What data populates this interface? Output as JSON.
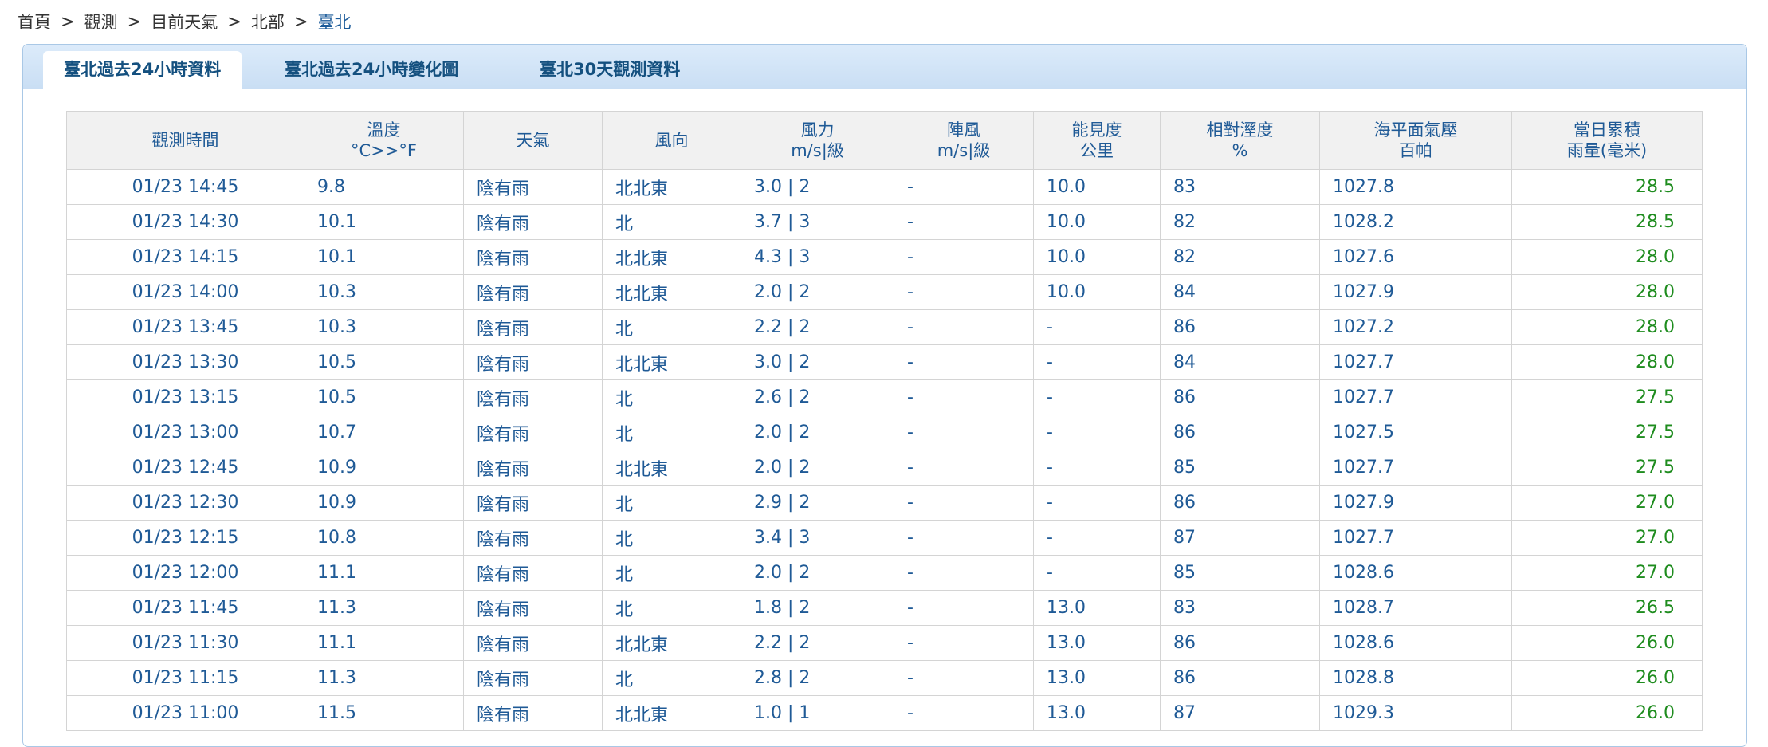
{
  "breadcrumb": {
    "home": "首頁",
    "observe": "觀測",
    "current": "目前天氣",
    "region": "北部",
    "city": "臺北",
    "separator": ">"
  },
  "tabs": [
    {
      "label_prefix": "臺北過去",
      "label_num": "24",
      "label_suffix": "小時資料",
      "active": true
    },
    {
      "label_prefix": "臺北過去",
      "label_num": "24",
      "label_suffix": "小時變化圖",
      "active": false
    },
    {
      "label_prefix": "臺北",
      "label_num": "30",
      "label_suffix": "天觀測資料",
      "active": false
    }
  ],
  "table": {
    "headers": [
      {
        "line1": "觀測時間",
        "line2": ""
      },
      {
        "line1": "溫度",
        "line2": "°C>>°F"
      },
      {
        "line1": "天氣",
        "line2": ""
      },
      {
        "line1": "風向",
        "line2": ""
      },
      {
        "line1": "風力",
        "line2": "m/s|級"
      },
      {
        "line1": "陣風",
        "line2": "m/s|級"
      },
      {
        "line1": "能見度",
        "line2": "公里"
      },
      {
        "line1": "相對溼度",
        "line2": "%"
      },
      {
        "line1": "海平面氣壓",
        "line2": "百帕"
      },
      {
        "line1": "當日累積",
        "line2": "雨量(毫米)"
      }
    ],
    "rows": [
      [
        "01/23 14:45",
        "9.8",
        "陰有雨",
        "北北東",
        "3.0 | 2",
        "-",
        "10.0",
        "83",
        "1027.8",
        "28.5"
      ],
      [
        "01/23 14:30",
        "10.1",
        "陰有雨",
        "北",
        "3.7 | 3",
        "-",
        "10.0",
        "82",
        "1028.2",
        "28.5"
      ],
      [
        "01/23 14:15",
        "10.1",
        "陰有雨",
        "北北東",
        "4.3 | 3",
        "-",
        "10.0",
        "82",
        "1027.6",
        "28.0"
      ],
      [
        "01/23 14:00",
        "10.3",
        "陰有雨",
        "北北東",
        "2.0 | 2",
        "-",
        "10.0",
        "84",
        "1027.9",
        "28.0"
      ],
      [
        "01/23 13:45",
        "10.3",
        "陰有雨",
        "北",
        "2.2 | 2",
        "-",
        "-",
        "86",
        "1027.2",
        "28.0"
      ],
      [
        "01/23 13:30",
        "10.5",
        "陰有雨",
        "北北東",
        "3.0 | 2",
        "-",
        "-",
        "84",
        "1027.7",
        "28.0"
      ],
      [
        "01/23 13:15",
        "10.5",
        "陰有雨",
        "北",
        "2.6 | 2",
        "-",
        "-",
        "86",
        "1027.7",
        "27.5"
      ],
      [
        "01/23 13:00",
        "10.7",
        "陰有雨",
        "北",
        "2.0 | 2",
        "-",
        "-",
        "86",
        "1027.5",
        "27.5"
      ],
      [
        "01/23 12:45",
        "10.9",
        "陰有雨",
        "北北東",
        "2.0 | 2",
        "-",
        "-",
        "85",
        "1027.7",
        "27.5"
      ],
      [
        "01/23 12:30",
        "10.9",
        "陰有雨",
        "北",
        "2.9 | 2",
        "-",
        "-",
        "86",
        "1027.9",
        "27.0"
      ],
      [
        "01/23 12:15",
        "10.8",
        "陰有雨",
        "北",
        "3.4 | 3",
        "-",
        "-",
        "87",
        "1027.7",
        "27.0"
      ],
      [
        "01/23 12:00",
        "11.1",
        "陰有雨",
        "北",
        "2.0 | 2",
        "-",
        "-",
        "85",
        "1028.6",
        "27.0"
      ],
      [
        "01/23 11:45",
        "11.3",
        "陰有雨",
        "北",
        "1.8 | 2",
        "-",
        "13.0",
        "83",
        "1028.7",
        "26.5"
      ],
      [
        "01/23 11:30",
        "11.1",
        "陰有雨",
        "北北東",
        "2.2 | 2",
        "-",
        "13.0",
        "86",
        "1028.6",
        "26.0"
      ],
      [
        "01/23 11:15",
        "11.3",
        "陰有雨",
        "北",
        "2.8 | 2",
        "-",
        "13.0",
        "86",
        "1028.8",
        "26.0"
      ],
      [
        "01/23 11:00",
        "11.5",
        "陰有雨",
        "北北東",
        "1.0 | 1",
        "-",
        "13.0",
        "87",
        "1029.3",
        "26.0"
      ]
    ]
  },
  "colors": {
    "link": "#1f5a96",
    "rain": "#1e8c1e",
    "tabbar": "#c9def4",
    "header_bg": "#f1f1f1"
  }
}
